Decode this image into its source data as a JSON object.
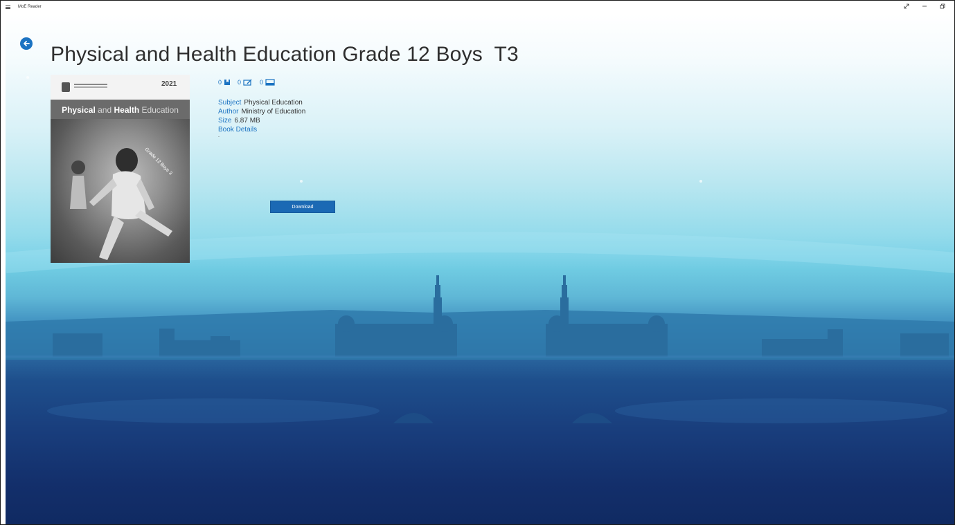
{
  "app": {
    "title": "MoE Reader"
  },
  "icons": {
    "menu": "hamburger-icon",
    "back": "back-arrow-icon",
    "resize": "resize-icon",
    "minimize": "minimize-icon",
    "restore": "restore-icon",
    "bookmark": "bookmark-icon",
    "note": "note-icon",
    "highlight": "highlight-icon"
  },
  "colors": {
    "accent": "#1b73c2",
    "download_button": "#1b69b4",
    "title_text": "#2e2e2e"
  },
  "book": {
    "title": "Physical and Health Education Grade 12 Boys  T3",
    "cover": {
      "heading_bold_1": "Physical",
      "heading_light_1": "and",
      "heading_bold_2": "Health",
      "heading_light_2": "Education",
      "year": "2021",
      "grade": "Grade 12 Boys 3"
    },
    "stats": {
      "bookmarks": "0",
      "notes": "0",
      "highlights": "0"
    },
    "details": {
      "subject_label": "Subject",
      "subject_value": "Physical Education",
      "author_label": "Author",
      "author_value": "Ministry of Education",
      "size_label": "Size",
      "size_value": "6.87 MB",
      "book_details_link": "Book Details",
      "description": "-"
    },
    "download_label": "Download"
  }
}
